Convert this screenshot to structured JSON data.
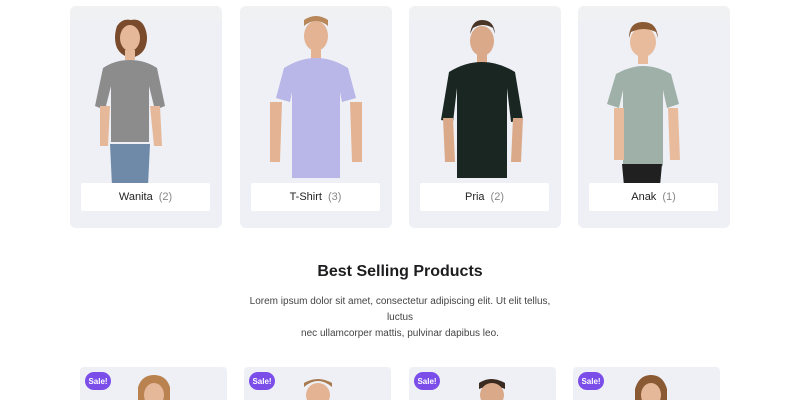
{
  "categories": [
    {
      "name": "Wanita",
      "count": "(2)",
      "image": "woman-grey-tshirt"
    },
    {
      "name": "T-Shirt",
      "count": "(3)",
      "image": "man-lavender-polo"
    },
    {
      "name": "Pria",
      "count": "(2)",
      "image": "man-black-tshirt"
    },
    {
      "name": "Anak",
      "count": "(1)",
      "image": "boy-grey-polo"
    }
  ],
  "best_selling": {
    "title": "Best Selling Products",
    "description_line1": "Lorem ipsum dolor sit amet, consectetur adipiscing elit. Ut elit tellus, luctus",
    "description_line2": "nec ullamcorper mattis, pulvinar dapibus leo."
  },
  "products": [
    {
      "badge": "Sale!",
      "image": "woman-product-photo"
    },
    {
      "badge": "Sale!",
      "image": "man-product-photo"
    },
    {
      "badge": "Sale!",
      "image": "man-product-photo"
    },
    {
      "badge": "Sale!",
      "image": "woman-product-photo"
    }
  ],
  "colors": {
    "card_bg": "#eef0f6",
    "sale_badge": "#7b4de9"
  }
}
